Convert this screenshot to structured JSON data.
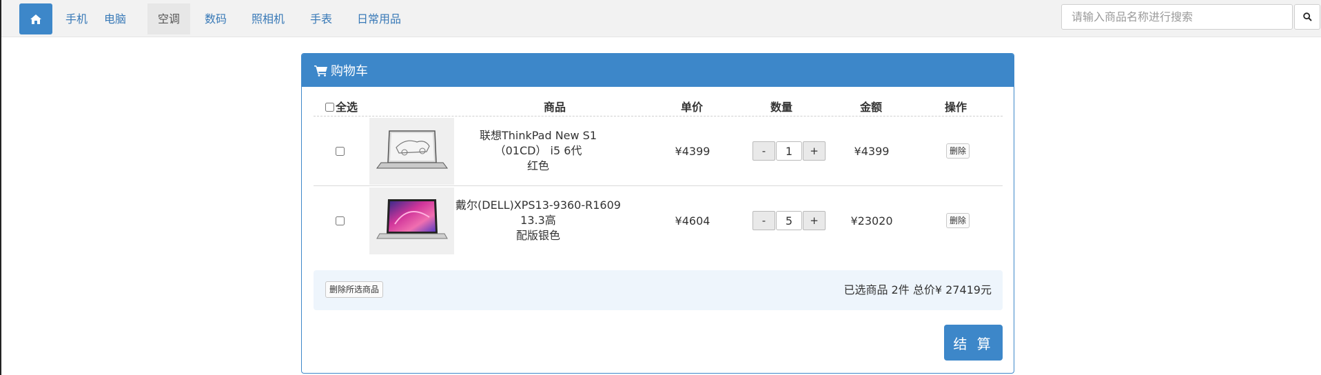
{
  "navbar": {
    "home_icon": "home-icon",
    "items": [
      {
        "label": "手机",
        "active": false
      },
      {
        "label": "电脑",
        "active": false
      },
      {
        "label": "空调",
        "active": true
      },
      {
        "label": "数码",
        "active": false
      },
      {
        "label": "照相机",
        "active": false
      },
      {
        "label": "手表",
        "active": false
      },
      {
        "label": "日常用品",
        "active": false
      }
    ],
    "search": {
      "placeholder": "请输入商品名称进行搜索",
      "value": "",
      "icon": "search-icon"
    }
  },
  "cart": {
    "title": "购物车",
    "title_icon": "shopping-cart-icon",
    "headers": {
      "select_all": "全选",
      "product": "商品",
      "unit_price": "单价",
      "quantity": "数量",
      "amount": "金额",
      "action": "操作"
    },
    "items": [
      {
        "name": "联想ThinkPad New S1（01CD） i5 6代红色",
        "name_line1": "联想ThinkPad New S1（01CD） i5 6代",
        "name_line2": "红色",
        "unit_price": "¥4399",
        "quantity": "1",
        "amount": "¥4399",
        "delete_label": "删除",
        "minus_label": "-",
        "plus_label": "+"
      },
      {
        "name": "戴尔(DELL)XPS13-9360-R1609 13.3高配版银色",
        "name_line1": "戴尔(DELL)XPS13-9360-R1609 13.3高",
        "name_line2": "配版银色",
        "unit_price": "¥4604",
        "quantity": "5",
        "amount": "¥23020",
        "delete_label": "删除",
        "minus_label": "-",
        "plus_label": "+"
      }
    ],
    "delete_selected_label": "删除所选商品",
    "summary_text": "已选商品 2件 总价¥ 27419元",
    "checkout_label": "结 算"
  },
  "colors": {
    "primary": "#3d87c9",
    "nav_link": "#3879b7",
    "summary_bg": "#eef5fc"
  }
}
